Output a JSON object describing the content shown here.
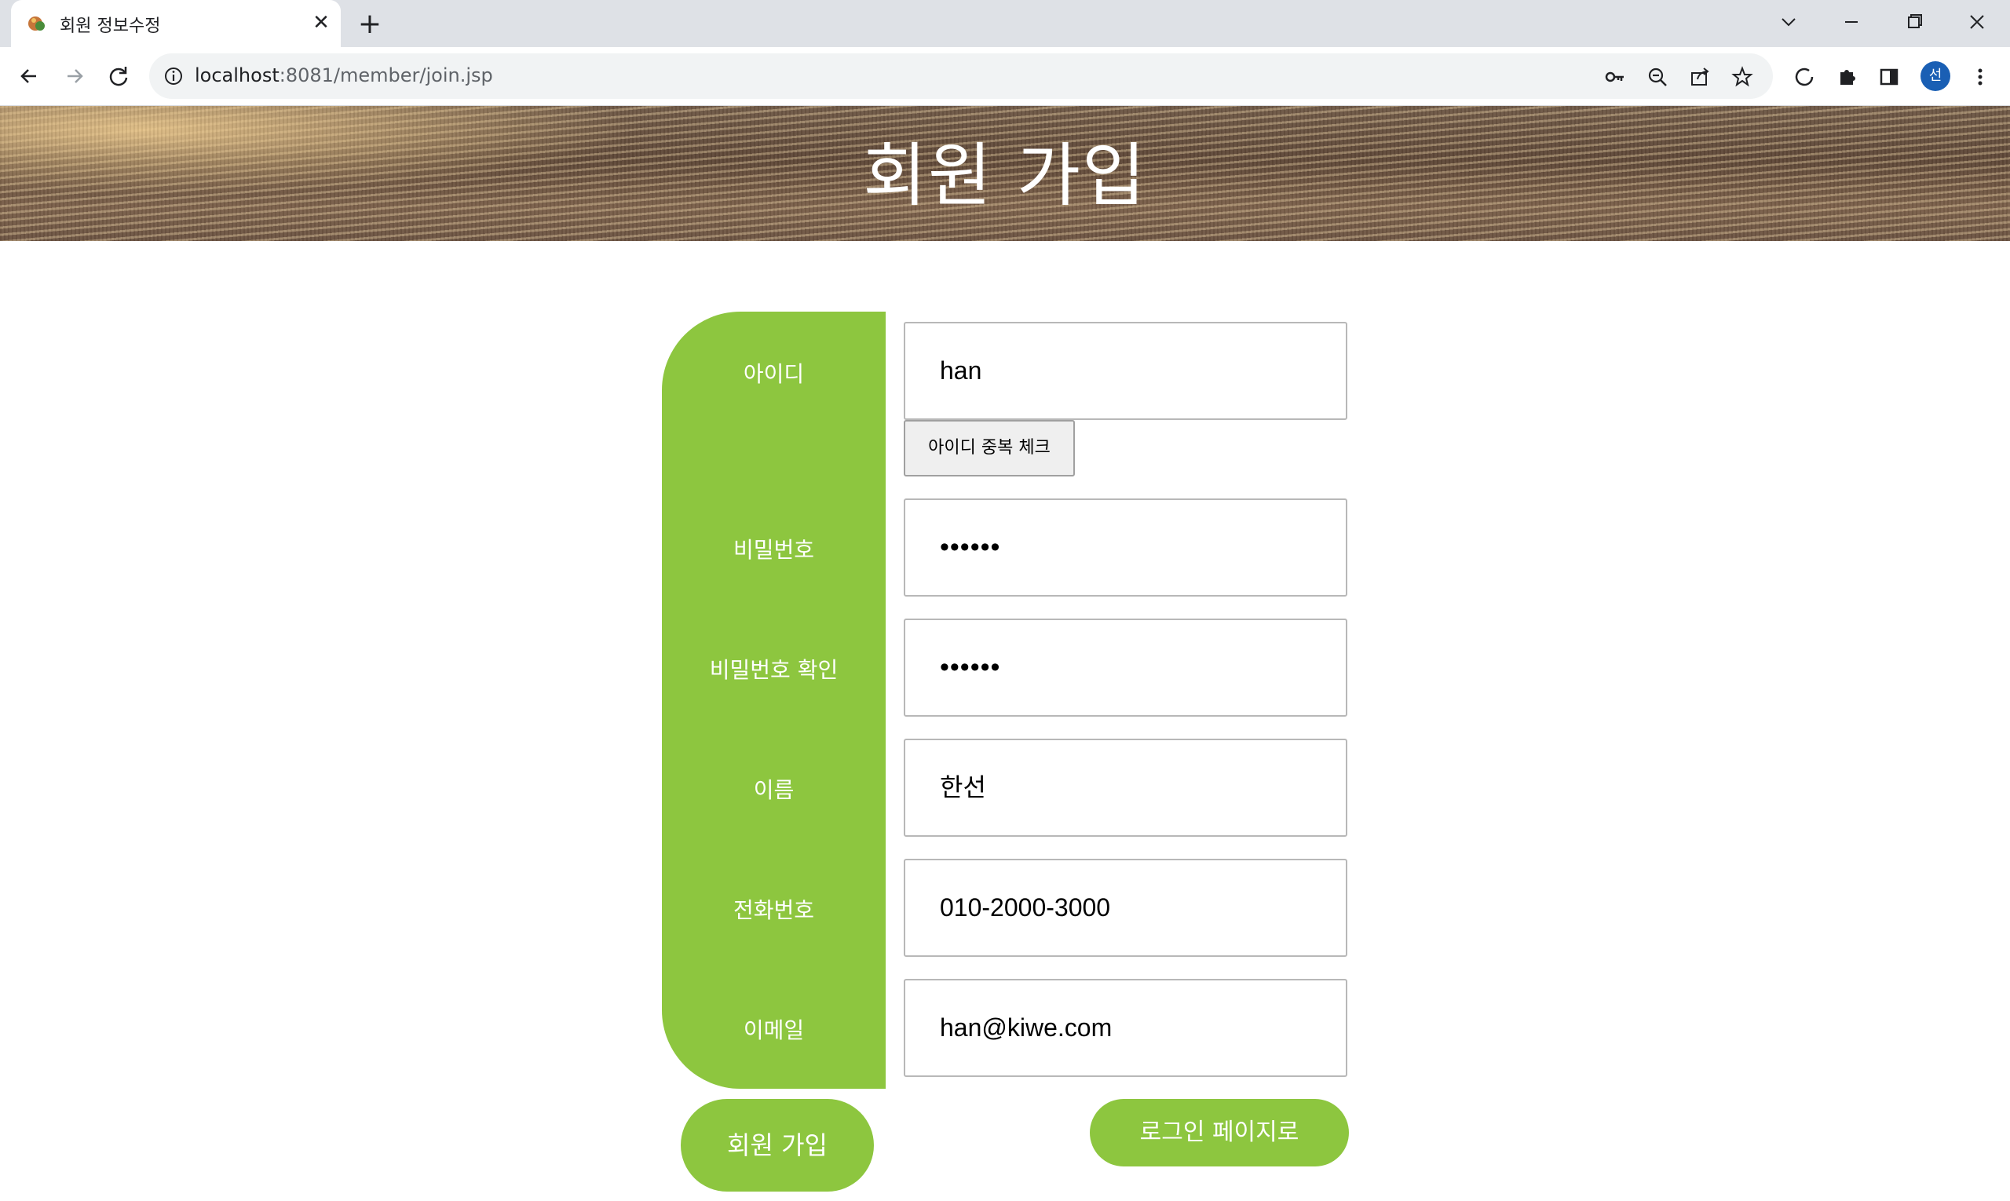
{
  "browser": {
    "tab_title": "회원 정보수정",
    "url_host": "localhost",
    "url_path": ":8081/member/join.jsp",
    "profile_initial": "선"
  },
  "page": {
    "title": "회원 가입"
  },
  "form": {
    "fields": [
      {
        "label": "아이디",
        "value": "han"
      },
      {
        "label": "비밀번호",
        "value": "••••••"
      },
      {
        "label": "비밀번호 확인",
        "value": "••••••"
      },
      {
        "label": "이름",
        "value": "한선"
      },
      {
        "label": "전화번호",
        "value": "010-2000-3000"
      },
      {
        "label": "이메일",
        "value": "han@kiwe.com"
      }
    ],
    "id_check_button": "아이디 중복 체크",
    "submit_button": "회원 가입",
    "login_link_button": "로그인 페이지로"
  },
  "colors": {
    "accent_green": "#8dc63f",
    "profile_blue": "#1a5fb4"
  }
}
